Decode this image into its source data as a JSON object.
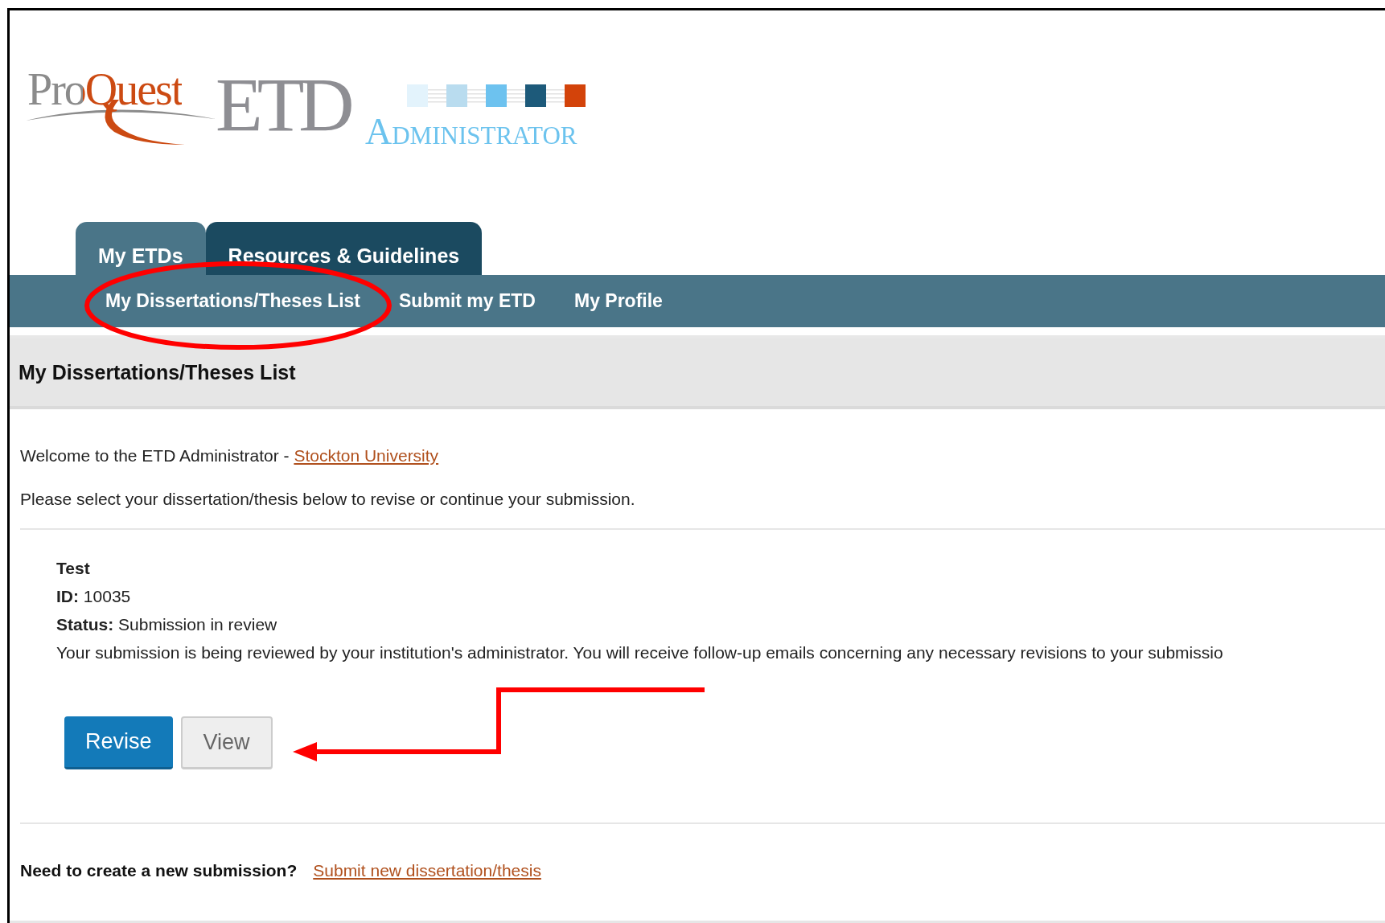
{
  "logo": {
    "brand": "ProQuest",
    "product": "ETD",
    "subtitle": "ADMINISTRATOR"
  },
  "tabs": [
    {
      "label": "My ETDs",
      "selected": true
    },
    {
      "label": "Resources & Guidelines",
      "selected": false
    }
  ],
  "subnav": [
    {
      "label": "My Dissertations/Theses List"
    },
    {
      "label": "Submit my ETD"
    },
    {
      "label": "My Profile"
    }
  ],
  "page_title": "My Dissertations/Theses List",
  "welcome": {
    "text": "Welcome to the ETD Administrator - ",
    "link": "Stockton University"
  },
  "instructions": "Please select your dissertation/thesis below to revise or continue your submission.",
  "submission": {
    "title": "Test",
    "id_label": "ID:",
    "id": "10035",
    "status_label": "Status:",
    "status": "Submission in review",
    "message": "Your submission is being reviewed by your institution's administrator. You will receive follow-up emails concerning any necessary revisions to your submissio",
    "buttons": [
      {
        "label": "Revise",
        "kind": "primary"
      },
      {
        "label": "View",
        "kind": "secondary"
      }
    ]
  },
  "new_submission": {
    "prompt": "Need to create a new submission?",
    "link": "Submit new dissertation/thesis"
  }
}
